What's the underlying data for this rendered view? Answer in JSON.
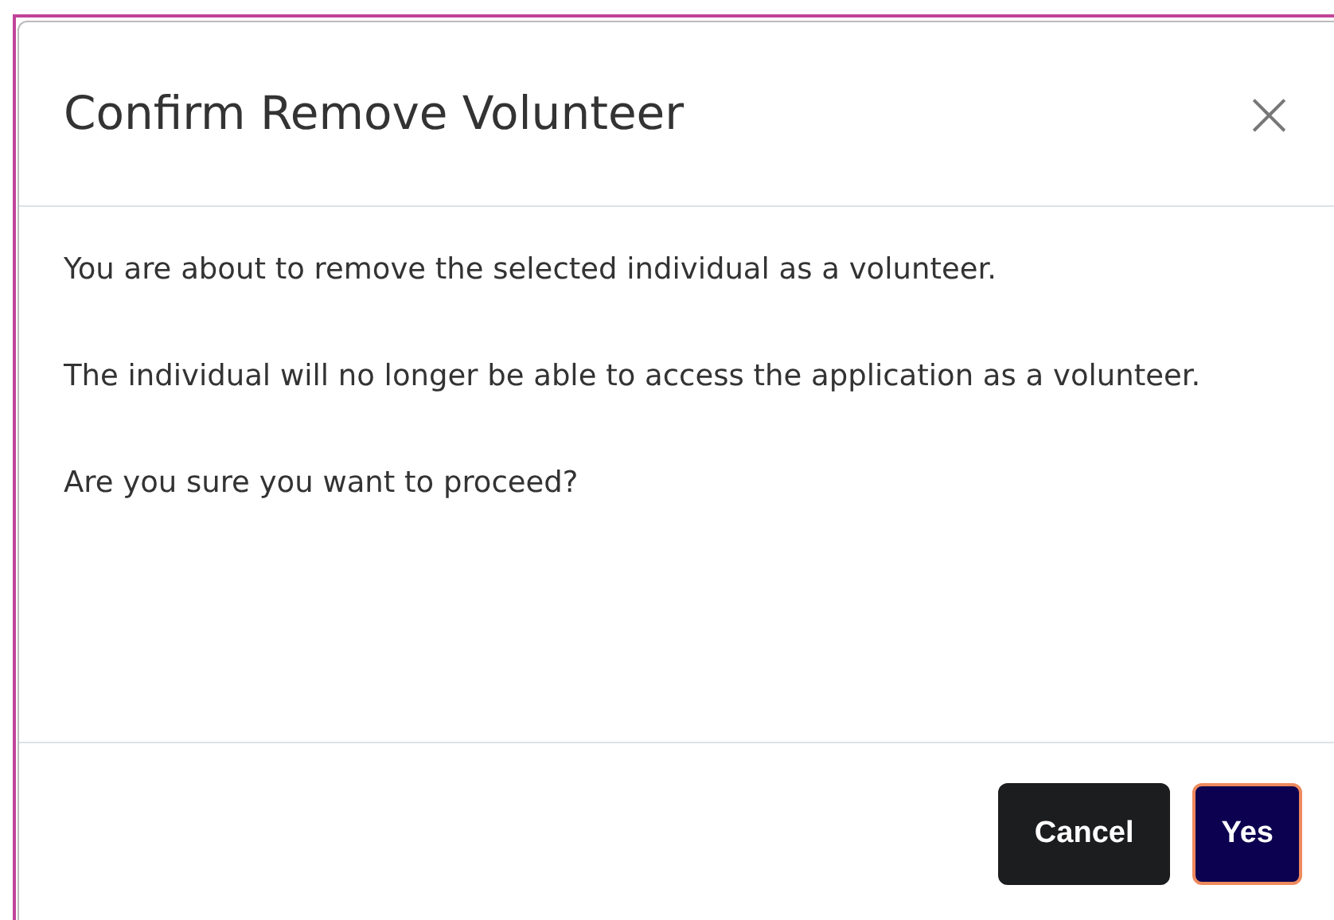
{
  "dialog": {
    "title": "Confirm Remove Volunteer",
    "close": "×",
    "paragraphs": [
      "You are about to remove the selected individual as a volunteer.",
      "The individual will no longer be able to access the application as a volunteer.",
      "Are you sure you want to proceed?"
    ],
    "buttons": [
      {
        "label": "Cancel",
        "kind": "secondary"
      },
      {
        "label": "Yes",
        "kind": "primary"
      }
    ]
  }
}
